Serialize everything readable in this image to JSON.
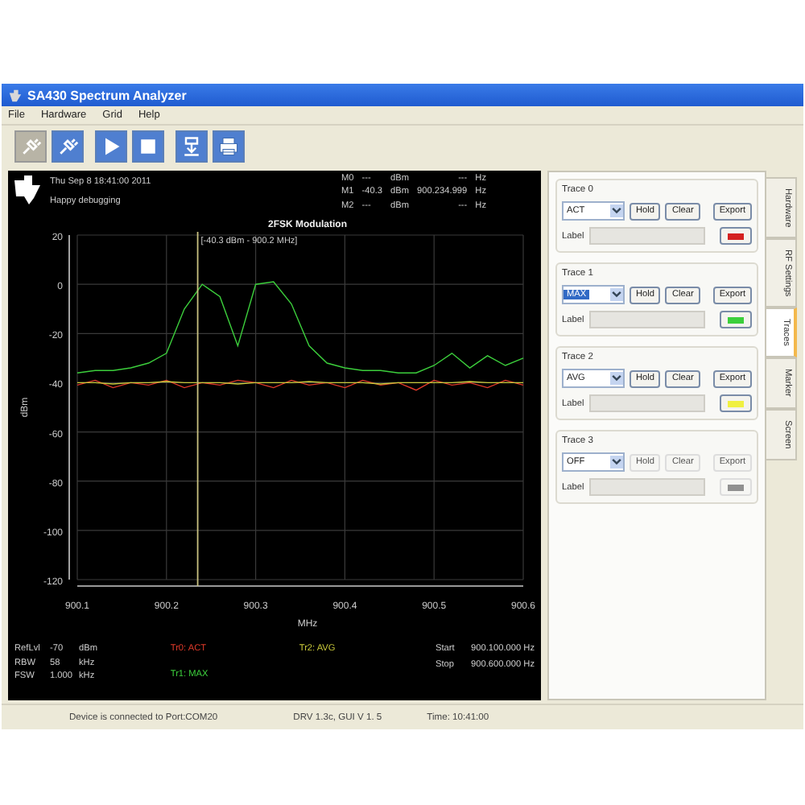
{
  "window": {
    "title": "SA430 Spectrum Analyzer"
  },
  "menu": [
    "File",
    "Hardware",
    "Grid",
    "Help"
  ],
  "toolbar": [
    {
      "kind": "connect",
      "disabled": true
    },
    {
      "kind": "disconnect",
      "disabled": false
    },
    {
      "kind": "play",
      "disabled": false
    },
    {
      "kind": "stop",
      "disabled": false
    },
    {
      "kind": "download",
      "disabled": false
    },
    {
      "kind": "print",
      "disabled": false
    }
  ],
  "plot_header": {
    "date": "Thu Sep 8 18:41:00 2011",
    "message": "Happy debugging",
    "markers": [
      {
        "name": "M0",
        "level": "---",
        "unit": "dBm",
        "freq": "---",
        "freq_unit": "Hz"
      },
      {
        "name": "M1",
        "level": "-40.3",
        "unit": "dBm",
        "freq": "900.234.999",
        "freq_unit": "Hz"
      },
      {
        "name": "M2",
        "level": "---",
        "unit": "dBm",
        "freq": "---",
        "freq_unit": "Hz"
      }
    ]
  },
  "plot": {
    "chart_data": {
      "type": "line",
      "title": "2FSK Modulation",
      "xlabel": "MHz",
      "ylabel": "dBm",
      "grid": true,
      "ref_lines": [
        {
          "axis": "x",
          "value": 900.235,
          "label": "[-40.3 dBm - 900.2 MHz]"
        }
      ],
      "x": [
        900.1,
        900.12,
        900.14,
        900.16,
        900.18,
        900.2,
        900.22,
        900.24,
        900.26,
        900.28,
        900.3,
        900.32,
        900.34,
        900.36,
        900.38,
        900.4,
        900.42,
        900.44,
        900.46,
        900.48,
        900.5,
        900.52,
        900.54,
        900.56,
        900.58,
        900.6
      ],
      "xlim": [
        900.1,
        900.6
      ],
      "ylim": [
        -120,
        20
      ],
      "xticks": [
        900.1,
        900.2,
        900.3,
        900.4,
        900.5,
        900.6
      ],
      "yticks": [
        20,
        0,
        -20,
        -40,
        -60,
        -80,
        -100,
        -120
      ],
      "series": [
        {
          "name": "Tr0: ACT",
          "color": "#e03a2a",
          "values": [
            -41,
            -39,
            -42,
            -40,
            -41,
            -39,
            -42,
            -40,
            -41,
            -39,
            -40,
            -42,
            -39,
            -41,
            -40,
            -42,
            -39,
            -41,
            -40,
            -43,
            -39,
            -41,
            -40,
            -42,
            -39,
            -41
          ]
        },
        {
          "name": "Tr2: AVG",
          "color": "#c8c83a",
          "values": [
            -40,
            -40,
            -40.5,
            -40,
            -40,
            -39.5,
            -40,
            -40,
            -40,
            -40.5,
            -40,
            -40,
            -40,
            -39.5,
            -40,
            -40,
            -40,
            -40.5,
            -40,
            -40,
            -40,
            -40,
            -39.5,
            -40,
            -40,
            -40
          ]
        },
        {
          "name": "Tr1: MAX",
          "color": "#3ccf3c",
          "values": [
            -36,
            -35,
            -35,
            -34,
            -32,
            -28,
            -10,
            0,
            -5,
            -25,
            0,
            1,
            -8,
            -25,
            -32,
            -34,
            -35,
            -35,
            -36,
            -36,
            -33,
            -28,
            -34,
            -29,
            -33,
            -30
          ]
        }
      ]
    }
  },
  "plot_footer": {
    "params": [
      {
        "name": "RefLvl",
        "value": "-70",
        "unit": "dBm"
      },
      {
        "name": "RBW",
        "value": "58",
        "unit": "kHz"
      },
      {
        "name": "FSW",
        "value": "1.000",
        "unit": "kHz"
      }
    ],
    "range": [
      {
        "name": "Start",
        "value": "900.100.000 Hz"
      },
      {
        "name": "Stop",
        "value": "900.600.000 Hz"
      }
    ]
  },
  "traces": [
    {
      "title": "Trace 0",
      "mode": "ACT",
      "mode_selected": false,
      "buttons": [
        "Hold",
        "Clear",
        "Export"
      ],
      "label": "Label",
      "color": "#d42020",
      "disabled": false
    },
    {
      "title": "Trace 1",
      "mode": "MAX",
      "mode_selected": true,
      "buttons": [
        "Hold",
        "Clear",
        "Export"
      ],
      "label": "Label",
      "color": "#3ccf3c",
      "disabled": false
    },
    {
      "title": "Trace 2",
      "mode": "AVG",
      "mode_selected": false,
      "buttons": [
        "Hold",
        "Clear",
        "Export"
      ],
      "label": "Label",
      "color": "#f0f040",
      "disabled": false
    },
    {
      "title": "Trace 3",
      "mode": "OFF",
      "mode_selected": false,
      "buttons": [
        "Hold",
        "Clear",
        "Export"
      ],
      "label": "Label",
      "color": "#909090",
      "disabled": true
    }
  ],
  "side_tabs": [
    {
      "label": "Hardware",
      "selected": false
    },
    {
      "label": "RF Settings",
      "selected": false
    },
    {
      "label": "Traces",
      "selected": true
    },
    {
      "label": "Marker",
      "selected": false
    },
    {
      "label": "Screen",
      "selected": false
    }
  ],
  "status_bar": [
    "Device is connected to Port:COM20",
    "DRV 1.3c, GUI V 1. 5",
    "Time: 10:41:00"
  ]
}
